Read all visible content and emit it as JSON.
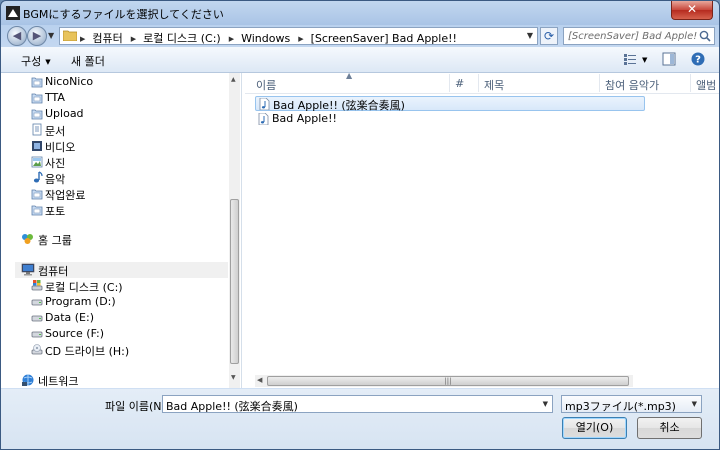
{
  "window": {
    "title": "BGMにするファイルを選択してください",
    "close_label": "✕"
  },
  "address_bar": {
    "breadcrumbs": [
      "컴퓨터",
      "로컬 디스크 (C:)",
      "Windows",
      "[ScreenSaver] Bad Apple!!"
    ],
    "search_placeholder": "[ScreenSaver] Bad Apple!! 검색"
  },
  "toolbar": {
    "organize_label": "구성",
    "new_folder_label": "새 폴더"
  },
  "nav_pane": {
    "library_items": [
      {
        "label": "NicoNico",
        "icon": "folder-icon"
      },
      {
        "label": "TTA",
        "icon": "folder-icon"
      },
      {
        "label": "Upload",
        "icon": "folder-icon"
      },
      {
        "label": "문서",
        "icon": "documents-icon"
      },
      {
        "label": "비디오",
        "icon": "video-icon"
      },
      {
        "label": "사진",
        "icon": "pictures-icon"
      },
      {
        "label": "음악",
        "icon": "music-icon"
      },
      {
        "label": "작업완료",
        "icon": "folder-icon"
      },
      {
        "label": "포토",
        "icon": "folder-icon"
      }
    ],
    "homegroup_label": "홈 그룹",
    "computer_label": "컴퓨터",
    "drives": [
      {
        "label": "로컬 디스크 (C:)",
        "icon": "system-drive-icon"
      },
      {
        "label": "Program (D:)",
        "icon": "drive-icon"
      },
      {
        "label": "Data (E:)",
        "icon": "drive-icon"
      },
      {
        "label": "Source (F:)",
        "icon": "drive-icon"
      },
      {
        "label": "CD 드라이브 (H:)",
        "icon": "cd-drive-icon"
      }
    ],
    "network_label": "네트워크"
  },
  "file_list": {
    "columns": [
      "이름",
      "#",
      "제목",
      "참여 음악가",
      "앨범"
    ],
    "files": [
      {
        "name": "Bad Apple!! (弦楽合奏風)",
        "selected": true
      },
      {
        "name": "Bad Apple!!",
        "selected": false
      }
    ]
  },
  "bottom": {
    "filename_label": "파일 이름(N):",
    "filename_value": "Bad Apple!! (弦楽合奏風)",
    "filetype_value": "mp3ファイル(*.mp3)",
    "open_label": "열기(O)",
    "cancel_label": "취소"
  },
  "colors": {
    "selection_fill": "#d8e8fa",
    "selection_border": "#98c4ee",
    "frame": "#a9c4e6"
  }
}
